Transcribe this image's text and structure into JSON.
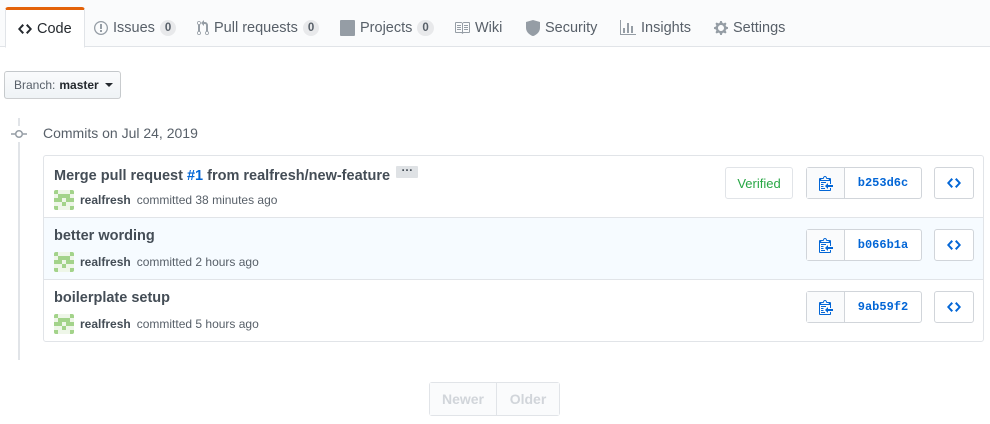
{
  "tabs": [
    {
      "label": "Code",
      "icon": "code-icon",
      "selected": true
    },
    {
      "label": "Issues",
      "icon": "issue-icon",
      "count": "0"
    },
    {
      "label": "Pull requests",
      "icon": "pull-request-icon",
      "count": "0"
    },
    {
      "label": "Projects",
      "icon": "project-icon",
      "count": "0"
    },
    {
      "label": "Wiki",
      "icon": "book-icon"
    },
    {
      "label": "Security",
      "icon": "shield-icon"
    },
    {
      "label": "Insights",
      "icon": "graph-icon"
    },
    {
      "label": "Settings",
      "icon": "gear-icon"
    }
  ],
  "branch": {
    "label": "Branch:",
    "value": "master"
  },
  "commit_group": {
    "title": "Commits on Jul 24, 2019"
  },
  "commits": [
    {
      "title_prefix": "Merge pull request ",
      "pr_link": "#1",
      "title_suffix": " from realfresh/new-feature",
      "author": "realfresh",
      "meta": "committed 38 minutes ago",
      "verified": "Verified",
      "sha": "b253d6c"
    },
    {
      "title": "better wording",
      "author": "realfresh",
      "meta": "committed 2 hours ago",
      "sha": "b066b1a"
    },
    {
      "title": "boilerplate setup",
      "author": "realfresh",
      "meta": "committed 5 hours ago",
      "sha": "9ab59f2"
    }
  ],
  "pagination": {
    "newer": "Newer",
    "older": "Older"
  },
  "colors": {
    "accent": "#e36209",
    "link": "#0366d6",
    "verified": "#28a745",
    "row_highlight": "#f6fbff"
  }
}
